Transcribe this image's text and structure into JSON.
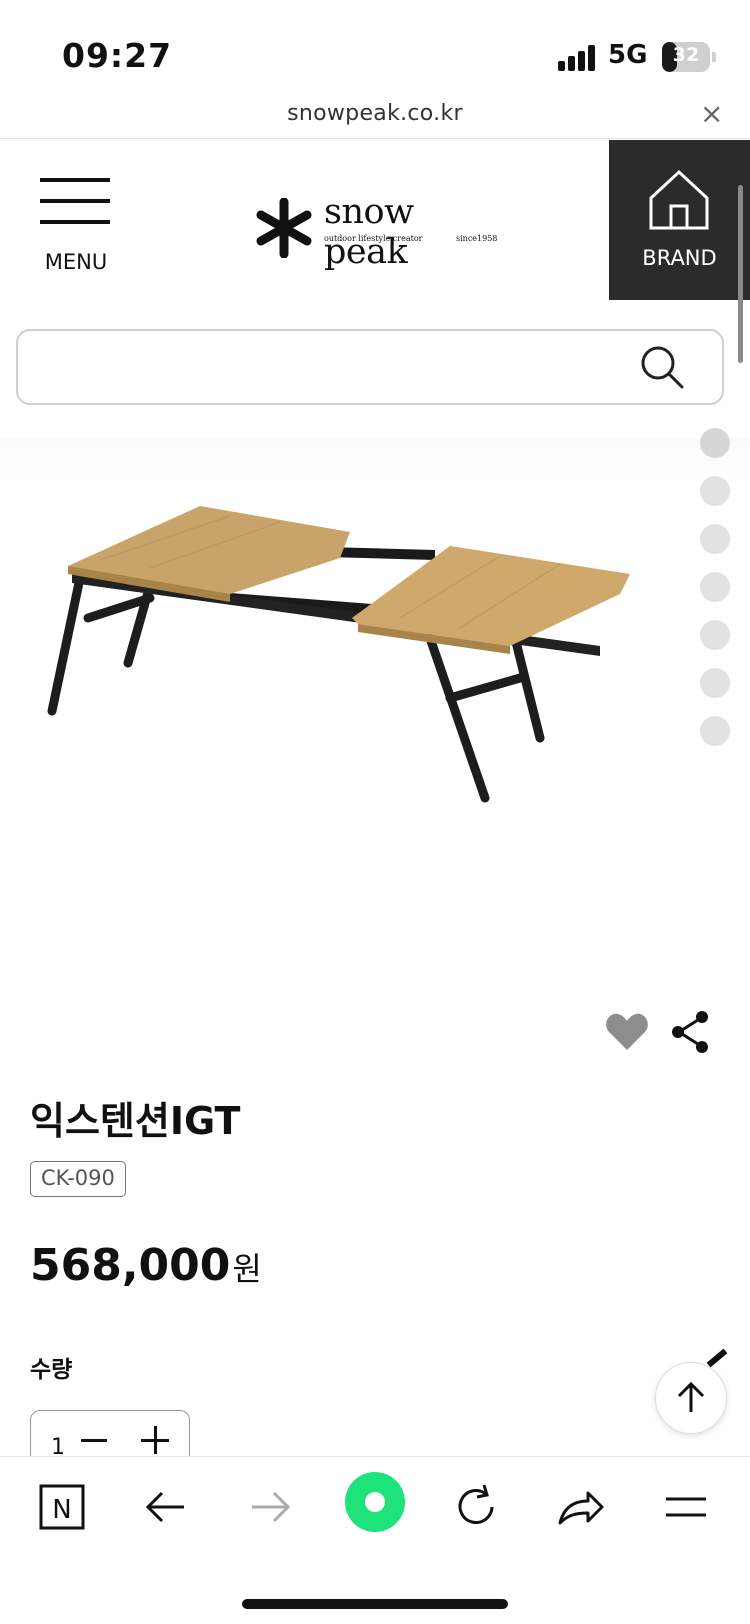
{
  "status_bar": {
    "time": "09:27",
    "network": "5G",
    "battery": "32",
    "battery_level": 0.32
  },
  "browser": {
    "url": "snowpeak.co.kr",
    "close_icon": "close-icon"
  },
  "header": {
    "menu_label": "MENU",
    "logo": {
      "name": "snow peak",
      "tagline": "outdoor lifestyle creator",
      "since": "since1958"
    },
    "brand_label": "BRAND"
  },
  "search": {
    "placeholder": "",
    "icon": "search-icon"
  },
  "gallery": {
    "total_slides": 7,
    "active_slide": 1
  },
  "product": {
    "title": "익스텐션IGT",
    "sku": "CK-090",
    "price": "568,000",
    "currency": "원",
    "quantity_label": "수량",
    "quantity": "1"
  },
  "toolbar": {
    "items": [
      "naver-home-icon",
      "back-arrow-icon",
      "forward-arrow-icon",
      "green-dot-icon",
      "reload-icon",
      "share-arrow-icon",
      "menu-icon"
    ]
  },
  "colors": {
    "brand_bg": "#2b2b2b",
    "accent_green": "#1ee27a",
    "wood": "#c9a46a"
  }
}
